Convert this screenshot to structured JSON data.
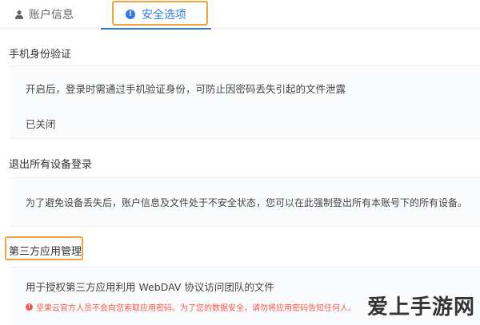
{
  "tabs": {
    "account_label": "账户信息",
    "security_label": "安全选项",
    "security_icon_text": "!"
  },
  "sections": {
    "phone_verification": {
      "title": "手机身份验证",
      "description": "开启后，登录时需通过手机验证身份，可防止因密码丢失引起的文件泄露",
      "status": "已关闭"
    },
    "logout_all": {
      "title": "退出所有设备登录",
      "description": "为了避免设备丢失后，账户信息及文件处于不安全状态，您可以在此强制登出所有本账号下的所有设备。"
    },
    "third_party": {
      "title": "第三方应用管理",
      "description": "用于授权第三方应用利用 WebDAV 协议访问团队的文件",
      "warning": "坚果云官方人员不会向您索取应用密码。为了您的数据安全，请勿将应用密码告知任何人。"
    }
  },
  "watermark": "爱上手游网",
  "colors": {
    "accent": "#2f7be5",
    "highlight_outline": "#f2a13b",
    "warning": "#f05a4e"
  }
}
